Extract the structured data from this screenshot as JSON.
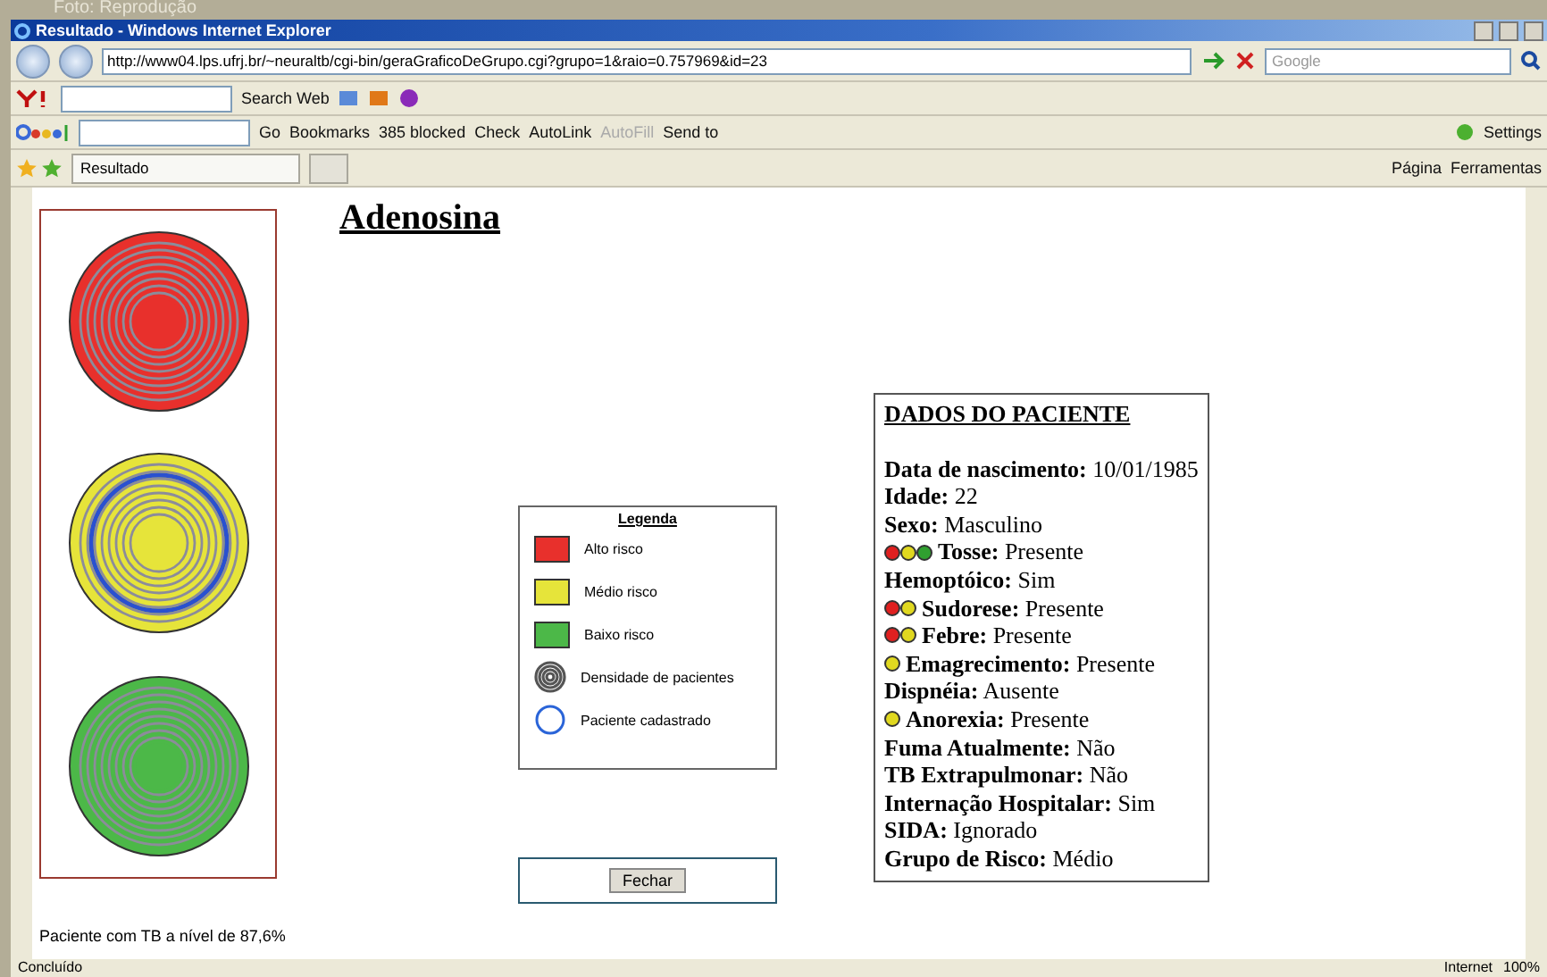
{
  "caption": "Foto: Reprodução",
  "window": {
    "title": "Resultado - Windows Internet Explorer"
  },
  "address_bar": {
    "url": "http://www04.lps.ufrj.br/~neuraltb/cgi-bin/geraGraficoDeGrupo.cgi?grupo=1&raio=0.757969&id=23",
    "search_placeholder": "Google"
  },
  "yahoo_toolbar": {
    "search_button": "Search Web"
  },
  "google_toolbar": {
    "items": [
      {
        "label": "Go",
        "disabled": false
      },
      {
        "label": "Bookmarks",
        "disabled": false
      },
      {
        "label": "385 blocked",
        "disabled": false
      },
      {
        "label": "Check",
        "disabled": false
      },
      {
        "label": "AutoLink",
        "disabled": false
      },
      {
        "label": "AutoFill",
        "disabled": true
      },
      {
        "label": "Send to",
        "disabled": false
      }
    ],
    "settings": "Settings"
  },
  "tab_bar": {
    "tabs": [
      {
        "label": "Resultado",
        "selected": true
      }
    ],
    "commands": [
      "Página",
      "Ferramentas"
    ]
  },
  "page": {
    "title": "Adenosina",
    "risk_circles": [
      {
        "color": "#e8302c",
        "patient_marker": false
      },
      {
        "color": "#e6e43a",
        "patient_marker": true
      },
      {
        "color": "#4cb848",
        "patient_marker": false
      }
    ],
    "legend": {
      "title": "Legenda",
      "items": [
        {
          "kind": "swatch",
          "color": "#e8302c",
          "label": "Alto risco"
        },
        {
          "kind": "swatch",
          "color": "#e6e43a",
          "label": "Médio risco"
        },
        {
          "kind": "swatch",
          "color": "#4cb848",
          "label": "Baixo risco"
        },
        {
          "kind": "density",
          "label": "Densidade de pacientes"
        },
        {
          "kind": "ring",
          "color": "#2a64d8",
          "label": "Paciente cadastrado"
        }
      ]
    },
    "close_button": "Fechar",
    "patient": {
      "title": "DADOS DO PACIENTE",
      "fields": [
        {
          "label": "Data de nascimento:",
          "value": "10/01/1985"
        },
        {
          "label": "Idade:",
          "value": "22"
        },
        {
          "label": "Sexo:",
          "value": "Masculino"
        },
        {
          "label": "Tosse:",
          "value": "Presente",
          "indicators": [
            {
              "color": "#e02020"
            },
            {
              "color": "#e0d820"
            },
            {
              "color": "#30a030"
            }
          ]
        },
        {
          "label": "Hemoptóico:",
          "value": "Sim"
        },
        {
          "label": "Sudorese:",
          "value": "Presente",
          "indicators": [
            {
              "color": "#e02020"
            },
            {
              "color": "#e0d820"
            }
          ]
        },
        {
          "label": "Febre:",
          "value": "Presente",
          "indicators": [
            {
              "color": "#e02020"
            },
            {
              "color": "#e0d820"
            }
          ]
        },
        {
          "label": "Emagrecimento:",
          "value": "Presente",
          "indicators": [
            {
              "color": "#e0d820"
            }
          ]
        },
        {
          "label": "Dispnéia:",
          "value": "Ausente"
        },
        {
          "label": "Anorexia:",
          "value": "Presente",
          "indicators": [
            {
              "color": "#e0d820"
            }
          ]
        },
        {
          "label": "Fuma Atualmente:",
          "value": "Não"
        },
        {
          "label": "TB Extrapulmonar:",
          "value": "Não"
        },
        {
          "label": "Internação Hospitalar:",
          "value": "Sim"
        },
        {
          "label": "SIDA:",
          "value": "Ignorado"
        },
        {
          "label": "Grupo de Risco:",
          "value": "Médio"
        }
      ]
    },
    "footer": "Paciente com TB a nível de 87,6%"
  },
  "status_bar": {
    "status": "Concluído",
    "zone": "Internet",
    "zoom": "100%"
  }
}
